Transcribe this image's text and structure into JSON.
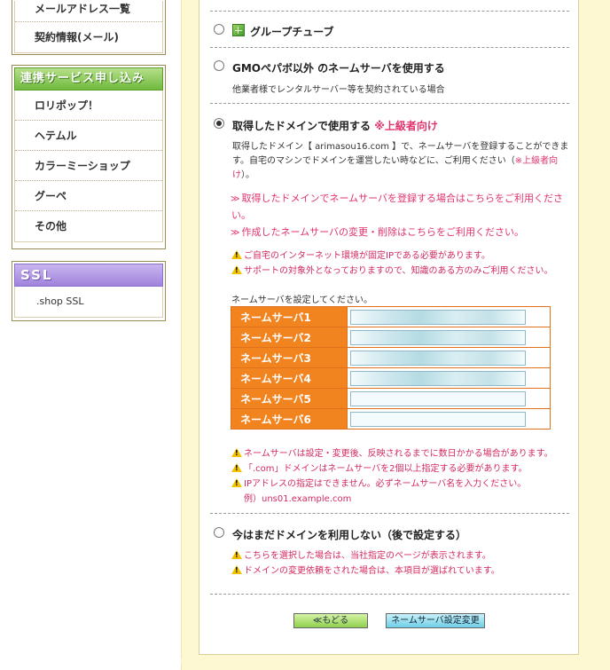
{
  "sidebar": {
    "top_box": {
      "items": [
        {
          "label": "メールアドレス一覧"
        },
        {
          "label": "契約情報(メール)"
        }
      ]
    },
    "linked_services": {
      "header": "連携サービス申し込み",
      "items": [
        {
          "label": "ロリポップ！"
        },
        {
          "label": "ヘテムル"
        },
        {
          "label": "カラーミーショップ"
        },
        {
          "label": "グーペ"
        },
        {
          "label": "その他"
        }
      ]
    },
    "ssl": {
      "header": "SSL",
      "items": [
        {
          "label": ".shop SSL"
        }
      ]
    }
  },
  "options": {
    "group_tube": {
      "label": "グループチューブ",
      "icon": "green-grid-icon",
      "selected": false
    },
    "other_ns": {
      "label": "GMOペパボ以外 のネームサーバを使用する",
      "desc": "他業者様でレンタルサーバー等を契約されている場合",
      "selected": false
    },
    "acquired": {
      "label": "取得したドメインで使用する",
      "tag": "※上級者向け",
      "desc1": "取得したドメイン【 arimasou16.com 】で、ネームサーバを登録することができま",
      "desc2_a": "す。自宅のマシンでドメインを運営したい時などに、ご利用ください（",
      "desc2_tag": "※上級者向",
      "desc3_tag": "け",
      "desc3_b": "）。",
      "link1_a": "取得したドメインでネームサーバを登録する場合はこちらをご利用くださ",
      "link1_b": "い。",
      "link2": "作成したネームサーバの変更・削除はこちらをご利用ください。",
      "warn1": "ご自宅のインターネット環境が固定IPである必要があります。",
      "warn2": "サポートの対象外となっておりますので、知識のある方のみご利用ください。",
      "ns_prompt": "ネームサーバを設定してください。",
      "selected": true
    },
    "later": {
      "label": "今はまだドメインを利用しない（後で設定する）",
      "warn1": "こちらを選択した場合は、当社指定のページが表示されます。",
      "warn2": "ドメインの変更依頼をされた場合は、本項目が選ばれています。",
      "selected": false
    }
  },
  "nameservers": {
    "rows": [
      {
        "label": "ネームサーバ1",
        "value": "",
        "filled": true
      },
      {
        "label": "ネームサーバ2",
        "value": "",
        "filled": true
      },
      {
        "label": "ネームサーバ3",
        "value": "",
        "filled": true
      },
      {
        "label": "ネームサーバ4",
        "value": "",
        "filled": true
      },
      {
        "label": "ネームサーバ5",
        "value": "",
        "filled": false
      },
      {
        "label": "ネームサーバ6",
        "value": "",
        "filled": false
      }
    ],
    "notes": [
      "ネームサーバは設定・変更後、反映されるまでに数日かかる場合があります。",
      "「.com」ドメインはネームサーバを2個以上指定する必要があります。",
      "IPアドレスの指定はできません。必ずネームサーバ名を入力ください。"
    ],
    "example": "例）uns01.example.com"
  },
  "buttons": {
    "back": "≪もどる",
    "change": "ネームサーバ設定変更"
  },
  "colors": {
    "accent_pink": "#e0346e",
    "table_orange": "#f2841f",
    "frame_cream": "#fdf8d2",
    "sidebar_green": "#6fb93d",
    "sidebar_purple": "#9f82dc"
  }
}
